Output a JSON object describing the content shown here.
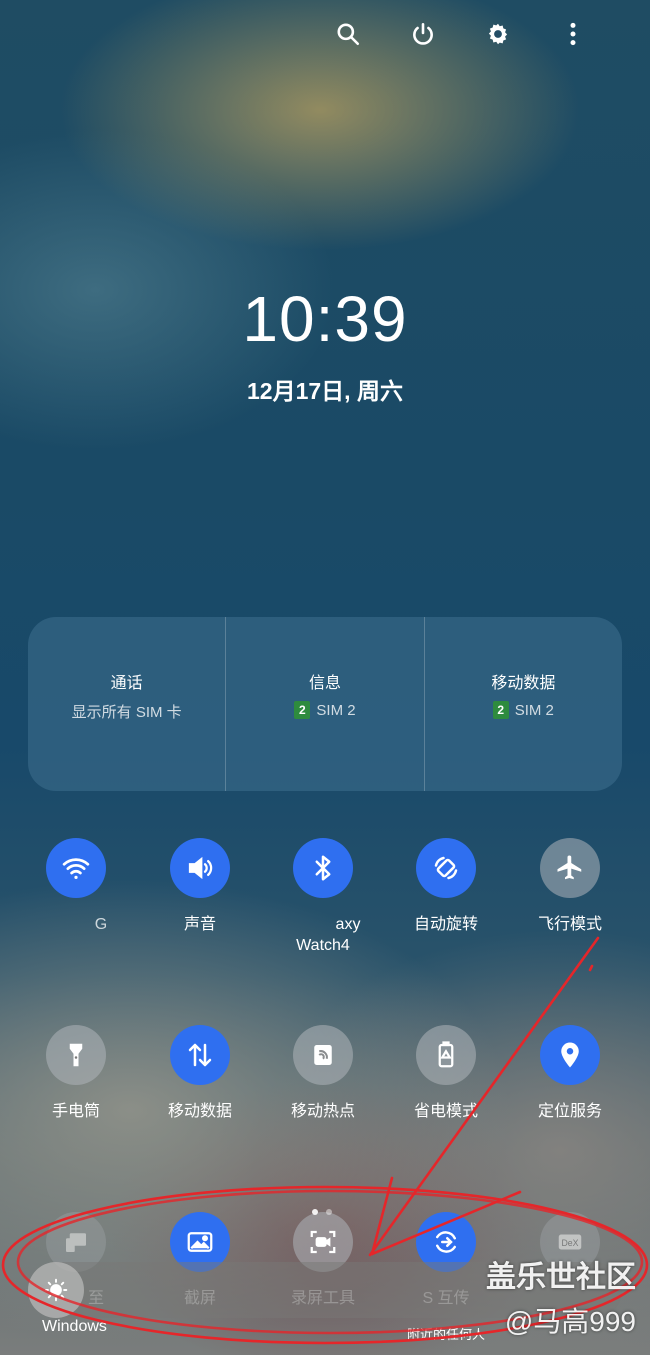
{
  "header": {
    "icons": [
      "search-icon",
      "power-icon",
      "gear-icon",
      "more-vert-icon"
    ]
  },
  "clock": {
    "time": "10:39",
    "date": "12月17日, 周六"
  },
  "sim_panel": {
    "calls": {
      "title": "通话",
      "subtitle": "显示所有 SIM 卡"
    },
    "messages": {
      "title": "信息",
      "sim_badge": "2",
      "sim_label": "SIM 2"
    },
    "mobile_data": {
      "title": "移动数据",
      "sim_badge": "2",
      "sim_label": "SIM 2"
    }
  },
  "tiles_row1": [
    {
      "label": "G",
      "icon": "wifi-icon",
      "state": "on"
    },
    {
      "label": "声音",
      "icon": "volume-icon",
      "state": "on"
    },
    {
      "label": "axy",
      "label2": "Watch4",
      "icon": "bluetooth-icon",
      "state": "on"
    },
    {
      "label": "自动旋转",
      "icon": "auto-rotate-icon",
      "state": "on"
    },
    {
      "label": "飞行模式",
      "icon": "airplane-icon",
      "state": "off"
    }
  ],
  "tiles_row2": [
    {
      "label": "手电筒",
      "icon": "flashlight-icon",
      "state": "off"
    },
    {
      "label": "移动数据",
      "icon": "data-arrows-icon",
      "state": "on"
    },
    {
      "label": "移动热点",
      "icon": "hotspot-icon",
      "state": "off"
    },
    {
      "label": "省电模式",
      "icon": "battery-saver-icon",
      "state": "off"
    },
    {
      "label": "定位服务",
      "icon": "location-icon",
      "state": "on"
    }
  ],
  "tiles_row3": [
    {
      "label": "至",
      "icon": "link-to-windows-icon",
      "state": "off"
    },
    {
      "label": "截屏",
      "icon": "screenshot-icon",
      "state": "on"
    },
    {
      "label": "录屏工具",
      "icon": "screen-recorder-icon",
      "state": "off"
    },
    {
      "label": "S 互传",
      "icon": "quick-share-icon",
      "state": "on"
    },
    {
      "label": "DeX",
      "icon": "dex-icon",
      "state": "off"
    }
  ],
  "bottom": {
    "windows_label": "Windows",
    "nearby_label": "附近的任何人"
  },
  "watermark": {
    "line1": "盖乐世社区",
    "line2": "@马高999"
  },
  "colors": {
    "tile_on": "#2f6ff0",
    "annotation": "#e5262a",
    "sim_badge": "#2e8b3e"
  }
}
